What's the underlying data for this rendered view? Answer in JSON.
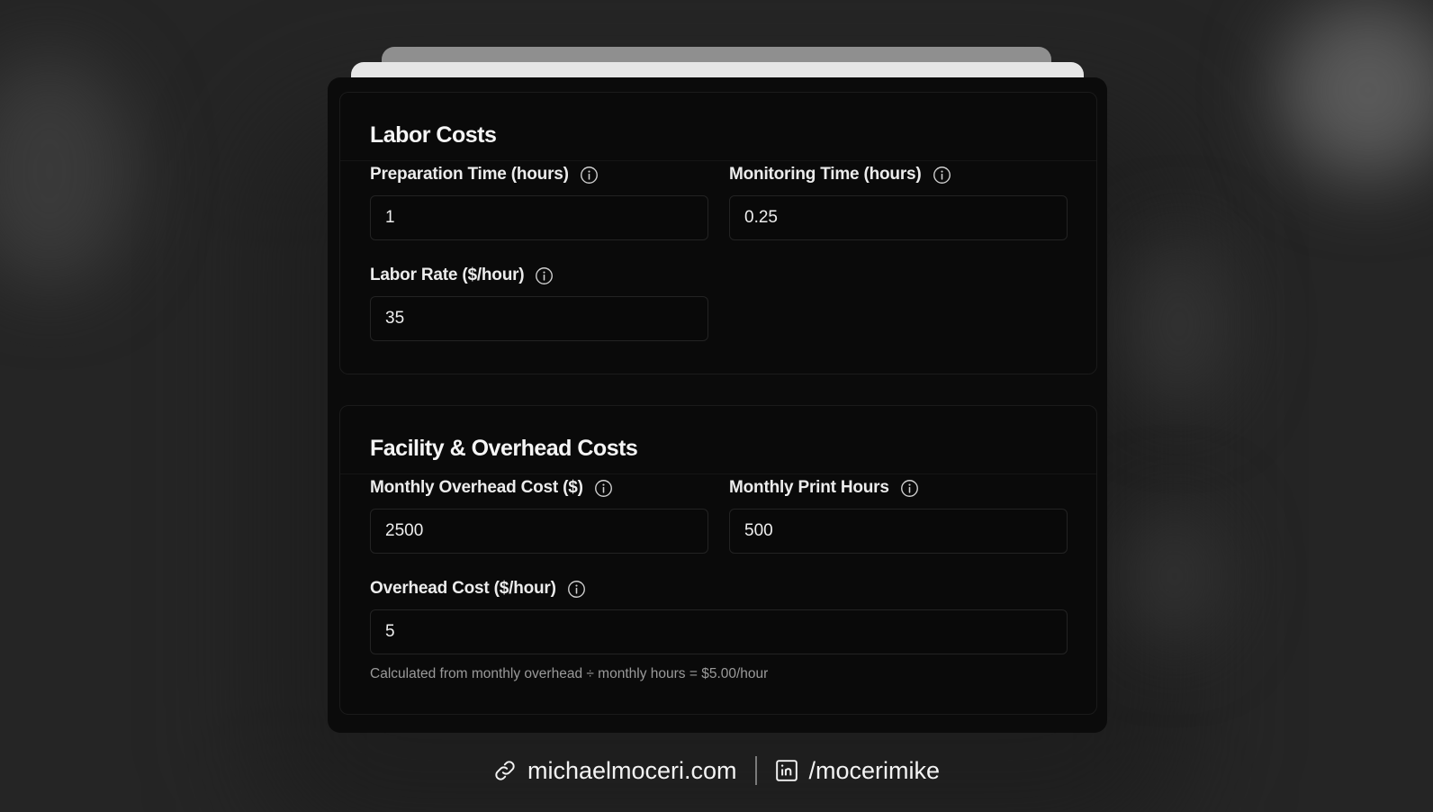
{
  "labor": {
    "title": "Labor Costs",
    "preparation_time": {
      "label": "Preparation Time (hours)",
      "value": "1"
    },
    "monitoring_time": {
      "label": "Monitoring Time (hours)",
      "value": "0.25"
    },
    "labor_rate": {
      "label": "Labor Rate ($/hour)",
      "value": "35"
    }
  },
  "facility": {
    "title": "Facility & Overhead Costs",
    "monthly_overhead": {
      "label": "Monthly Overhead Cost ($)",
      "value": "2500"
    },
    "monthly_print_hours": {
      "label": "Monthly Print Hours",
      "value": "500"
    },
    "overhead_cost": {
      "label": "Overhead Cost ($/hour)",
      "value": "5"
    },
    "help_text": "Calculated from monthly overhead ÷ monthly hours = $5.00/hour"
  },
  "footer": {
    "website": "michaelmoceri.com",
    "linkedin": "/mocerimike",
    "website_icon": "link-icon",
    "linkedin_icon": "linkedin-icon"
  },
  "colors": {
    "background": "#252525",
    "card": "#0b0b0b",
    "text": "#f2f2f2",
    "muted": "#9a9a9a"
  }
}
